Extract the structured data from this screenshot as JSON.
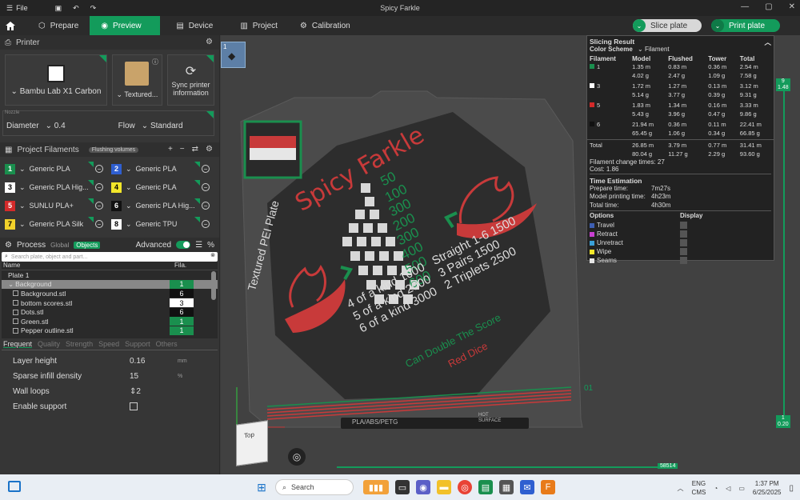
{
  "titlebar": {
    "file_label": "File",
    "title": "Spicy Farkle"
  },
  "nav": {
    "tabs": [
      {
        "label": "Prepare",
        "icon": "cube-icon"
      },
      {
        "label": "Preview",
        "icon": "eye-icon"
      },
      {
        "label": "Device",
        "icon": "device-icon"
      },
      {
        "label": "Project",
        "icon": "project-icon"
      },
      {
        "label": "Calibration",
        "icon": "calibration-icon"
      }
    ],
    "slice_label": "Slice plate",
    "print_label": "Print plate"
  },
  "printer": {
    "section_title": "Printer",
    "printer_name": "Bambu Lab X1 Carbon",
    "plate_name": "Textured...",
    "sync_label": "Sync printer information",
    "nozzle_label": "Nozzle",
    "diameter_label": "Diameter",
    "diameter_value": "0.4",
    "flow_label": "Flow",
    "flow_value": "Standard"
  },
  "filaments": {
    "section_title": "Project Filaments",
    "flushing_label": "Flushing volumes",
    "items": [
      {
        "num": "1",
        "name": "Generic PLA",
        "color": "#1a8f4e",
        "text": "#fff"
      },
      {
        "num": "2",
        "name": "Generic PLA",
        "color": "#2f5fd0",
        "text": "#fff"
      },
      {
        "num": "3",
        "name": "Generic PLA Hig...",
        "color": "#ffffff",
        "text": "#000"
      },
      {
        "num": "4",
        "name": "Generic PLA",
        "color": "#f2e62a",
        "text": "#000"
      },
      {
        "num": "5",
        "name": "SUNLU PLA+",
        "color": "#d42a2a",
        "text": "#fff"
      },
      {
        "num": "6",
        "name": "Generic PLA Hig...",
        "color": "#111111",
        "text": "#fff"
      },
      {
        "num": "7",
        "name": "Generic PLA Silk",
        "color": "#f2d12a",
        "text": "#000"
      },
      {
        "num": "8",
        "name": "Generic TPU",
        "color": "#ffffff",
        "text": "#000"
      }
    ]
  },
  "process": {
    "title": "Process",
    "global_label": "Global",
    "objects_label": "Objects",
    "advanced_label": "Advanced",
    "search_placeholder": "Search plate, object and part...",
    "col_name": "Name",
    "col_fila": "Fila.",
    "tree": [
      {
        "name": "Plate 1",
        "fila": "",
        "indent": 0
      },
      {
        "name": "Background",
        "fila": "1",
        "indent": 0
      },
      {
        "name": "Background.stl",
        "fila": "6",
        "indent": 1
      },
      {
        "name": "bottom scores.stl",
        "fila": "3",
        "indent": 1
      },
      {
        "name": "Dots.stl",
        "fila": "6",
        "indent": 1
      },
      {
        "name": "Green.stl",
        "fila": "1",
        "indent": 1
      },
      {
        "name": "Pepper outline.stl",
        "fila": "1",
        "indent": 1
      }
    ],
    "tabs": [
      "Frequent",
      "Quality",
      "Strength",
      "Speed",
      "Support",
      "Others"
    ],
    "settings": [
      {
        "label": "Layer height",
        "value": "0.16",
        "unit": "mm"
      },
      {
        "label": "Sparse infill density",
        "value": "15",
        "unit": "%"
      },
      {
        "label": "Wall loops",
        "value": "2",
        "unit": ""
      },
      {
        "label": "Enable support",
        "value": "",
        "unit": ""
      }
    ]
  },
  "viewport": {
    "plate_title": "Spicy Farkle",
    "plate_label": "Textured PEI Plate",
    "scores_a": [
      "50",
      "100",
      "300",
      "200",
      "300",
      "400",
      "500",
      "600"
    ],
    "line1": "Straight 1-6 1500",
    "line2": "3 Pairs 1500",
    "line3": "2 Triplets 2500",
    "line4": "4 of a kind 1000",
    "line5": "5 of a kind 2000",
    "line6": "6 of a kind 3000",
    "red_dice": "Red Dice",
    "double": "Can Double The Score",
    "plate_footer": "PLA/ABS/PETG",
    "hot_label": "HOT SURFACE",
    "view_label": "Top",
    "layer_top": "9",
    "layer_top2": "1.48",
    "layer_bot": "1",
    "layer_bot2": "0.20",
    "layer_marker": "01",
    "moves_value": "58514",
    "plate_number": "1"
  },
  "slicing": {
    "title": "Slicing Result",
    "color_scheme_label": "Color Scheme",
    "color_scheme_value": "Filament",
    "headers": [
      "Filament",
      "Model",
      "Flushed",
      "Tower",
      "Total"
    ],
    "rows": [
      {
        "id": "1",
        "color": "#1a8f4e",
        "model": [
          "1.35 m",
          "4.02 g"
        ],
        "flushed": [
          "0.83 m",
          "2.47 g"
        ],
        "tower": [
          "0.36 m",
          "1.09 g"
        ],
        "total": [
          "2.54 m",
          "7.58 g"
        ]
      },
      {
        "id": "3",
        "color": "#ffffff",
        "model": [
          "1.72 m",
          "5.14 g"
        ],
        "flushed": [
          "1.27 m",
          "3.77 g"
        ],
        "tower": [
          "0.13 m",
          "0.39 g"
        ],
        "total": [
          "3.12 m",
          "9.31 g"
        ]
      },
      {
        "id": "5",
        "color": "#d42a2a",
        "model": [
          "1.83 m",
          "5.43 g"
        ],
        "flushed": [
          "1.34 m",
          "3.96 g"
        ],
        "tower": [
          "0.16 m",
          "0.47 g"
        ],
        "total": [
          "3.33 m",
          "9.86 g"
        ]
      },
      {
        "id": "6",
        "color": "#111111",
        "model": [
          "21.94 m",
          "65.45 g"
        ],
        "flushed": [
          "0.36 m",
          "1.06 g"
        ],
        "tower": [
          "0.11 m",
          "0.34 g"
        ],
        "total": [
          "22.41 m",
          "66.85 g"
        ]
      }
    ],
    "total_label": "Total",
    "total": {
      "model": [
        "26.85 m",
        "80.04 g"
      ],
      "flushed": [
        "3.79 m",
        "11.27 g"
      ],
      "tower": [
        "0.77 m",
        "2.29 g"
      ],
      "total": [
        "31.41 m",
        "93.60 g"
      ]
    },
    "change_times": "Filament change times: 27",
    "cost": "Cost: 1.86",
    "time_title": "Time Estimation",
    "prepare_label": "Prepare time:",
    "prepare_value": "7m27s",
    "model_label": "Model printing time:",
    "model_value": "4h23m",
    "total_time_label": "Total time:",
    "total_time_value": "4h30m",
    "options_label": "Options",
    "display_label": "Display",
    "options": [
      {
        "name": "Travel",
        "color": "#3d5fb3"
      },
      {
        "name": "Retract",
        "color": "#c83fd0"
      },
      {
        "name": "Unretract",
        "color": "#3aa0d8"
      },
      {
        "name": "Wipe",
        "color": "#f2e62a"
      },
      {
        "name": "Seams",
        "color": "#e6e6e6"
      }
    ]
  },
  "taskbar": {
    "search": "Search",
    "lang1": "ENG",
    "lang2": "CMS",
    "time": "1:37 PM",
    "date": "6/25/2025"
  }
}
